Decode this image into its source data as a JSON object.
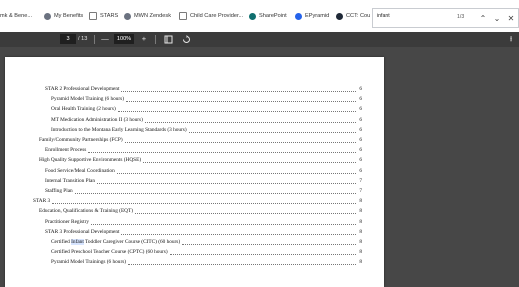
{
  "bookmarks": [
    {
      "label": "mk & Bene...",
      "icon": "bookmark-icon"
    },
    {
      "label": "My Benefits",
      "icon": "globe-icon"
    },
    {
      "label": "STARS",
      "icon": "star-icon"
    },
    {
      "label": "MWN Zendesk",
      "icon": "zendesk-icon"
    },
    {
      "label": "Child Care Provider...",
      "icon": "document-icon"
    },
    {
      "label": "SharePoint",
      "icon": "sharepoint-icon"
    },
    {
      "label": "EPyramid",
      "icon": "pyramid-icon"
    },
    {
      "label": "CCT: Cou",
      "icon": "cct-icon"
    }
  ],
  "find": {
    "value": "infant",
    "count": "1/3"
  },
  "toolbar": {
    "page_current": "3",
    "page_total": "/ 13",
    "zoom_out": "—",
    "zoom_level": "100%",
    "zoom_in": "+"
  },
  "toc": [
    {
      "text": "STAR 2 Professional Development",
      "page": "6",
      "indent": 1
    },
    {
      "text": "Pyramid Model Training (6 hours)",
      "page": "6",
      "indent": 2
    },
    {
      "text": "Oral Health Training (2 hours)",
      "page": "6",
      "indent": 2
    },
    {
      "text": "MT Medication Administration II (3 hours)",
      "page": "6",
      "indent": 2
    },
    {
      "text": "Introduction to the Montana Early Learning Standards (3 hours)",
      "page": "6",
      "indent": 2
    },
    {
      "text": "Family/Community Partnerships (FCP)",
      "page": "6",
      "indent": 0
    },
    {
      "text": "Enrollment Process",
      "page": "6",
      "indent": 1
    },
    {
      "text": "High Quality Supportive Environments (HQSE)",
      "page": "6",
      "indent": 0
    },
    {
      "text": "Food Service/Meal Coordination",
      "page": "6",
      "indent": 1
    },
    {
      "text": "Internal Transition Plan",
      "page": "7",
      "indent": 1
    },
    {
      "text": "Staffing Plan",
      "page": "7",
      "indent": 1
    },
    {
      "text": "STAR 3",
      "page": "8",
      "indent": -1
    },
    {
      "text": "Education, Qualifications & Training (EQT)",
      "page": "8",
      "indent": 0
    },
    {
      "text": "Practitioner Registry",
      "page": "8",
      "indent": 1
    },
    {
      "text": "STAR 3 Professional Development",
      "page": "8",
      "indent": 1
    },
    {
      "text_before": "Certified ",
      "text_hl": "Infant",
      "text_after": " Toddler Caregiver Course (CITC) (60 hours)",
      "page": "8",
      "indent": 2
    },
    {
      "text": "Certified Preschool Teacher Course (CPTC) (60 hours)",
      "page": "8",
      "indent": 2
    },
    {
      "text": "Pyramid Model Trainings (6 hours)",
      "page": "8",
      "indent": 2
    }
  ],
  "colors": {
    "toolbar": "#3b3b3b",
    "viewer_bg": "#474747",
    "highlight": "#d6e4ff"
  }
}
